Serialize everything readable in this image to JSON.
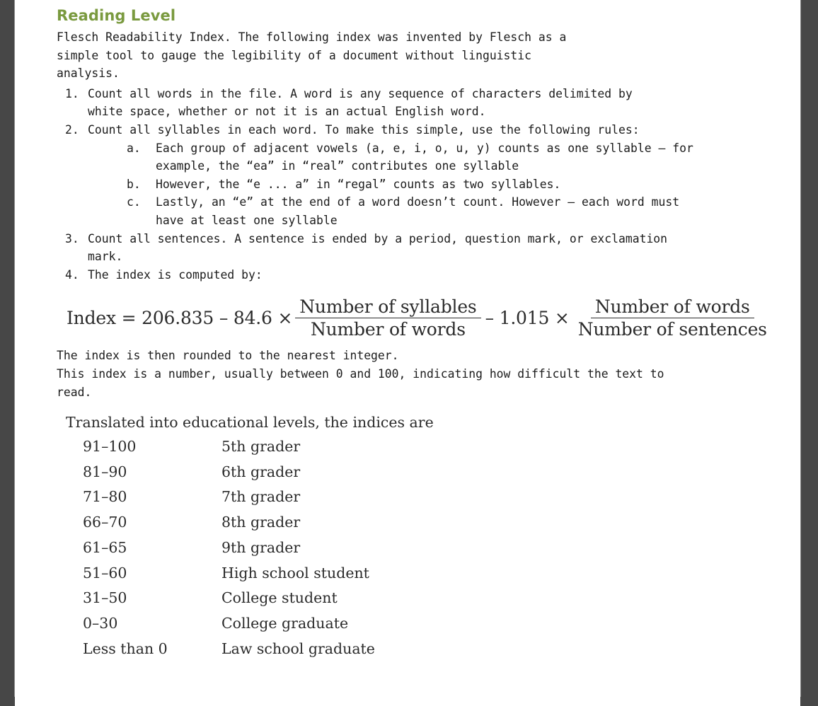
{
  "document": {
    "heading": "Reading Level",
    "intro": "Flesch Readability Index. The following index was invented by Flesch as a\nsimple tool to gauge the legibility of a document without linguistic\nanalysis.",
    "steps": [
      {
        "marker": "1.",
        "text": "Count all words in the file. A word is any sequence of characters delimited by\nwhite space, whether or not it is an actual English word."
      },
      {
        "marker": "2.",
        "text": "Count all syllables in each word. To make this simple, use the following rules:",
        "substeps": [
          {
            "marker": "a.",
            "text": "Each group of adjacent vowels (a, e, i, o, u, y) counts as one syllable – for\nexample, the “ea” in “real” contributes one syllable"
          },
          {
            "marker": "b.",
            "text": "However, the “e ... a” in “regal” counts as two syllables."
          },
          {
            "marker": "c.",
            "text": "Lastly, an “e” at the end of a word doesn’t count. However – each word must\nhave at least one syllable"
          }
        ]
      },
      {
        "marker": "3.",
        "text": "Count all sentences. A sentence is ended by a period, question mark, or exclamation\nmark."
      },
      {
        "marker": "4.",
        "text": "The index is computed by:"
      }
    ],
    "formula": {
      "lead": "Index = 206.835 – 84.6 ×",
      "frac1_numerator": "Number of syllables",
      "frac1_denominator": "Number of words",
      "middle_operator": "– 1.015 ×",
      "frac2_numerator": "Number of words",
      "frac2_denominator": "Number of sentences"
    },
    "after_formula": "The index is then rounded to the nearest integer.\nThis index is a number, usually between 0 and 100, indicating how difficult the text to\nread.",
    "levels_caption": "Translated into educational levels, the indices are",
    "levels": [
      {
        "range": "91–100",
        "level": "5th grader"
      },
      {
        "range": "81–90",
        "level": "6th grader"
      },
      {
        "range": "71–80",
        "level": "7th grader"
      },
      {
        "range": "66–70",
        "level": "8th grader"
      },
      {
        "range": "61–65",
        "level": "9th grader"
      },
      {
        "range": "51–60",
        "level": "High school student"
      },
      {
        "range": "31–50",
        "level": "College student"
      },
      {
        "range": "0–30",
        "level": "College graduate"
      },
      {
        "range": "Less than 0",
        "level": "Law school graduate"
      }
    ],
    "colors": {
      "heading_green": "#7a9a3f",
      "body_text": "#1c1c1c",
      "serif_text": "#2b2b2b",
      "page_background": "#ffffff",
      "window_chrome": "#474747"
    }
  }
}
